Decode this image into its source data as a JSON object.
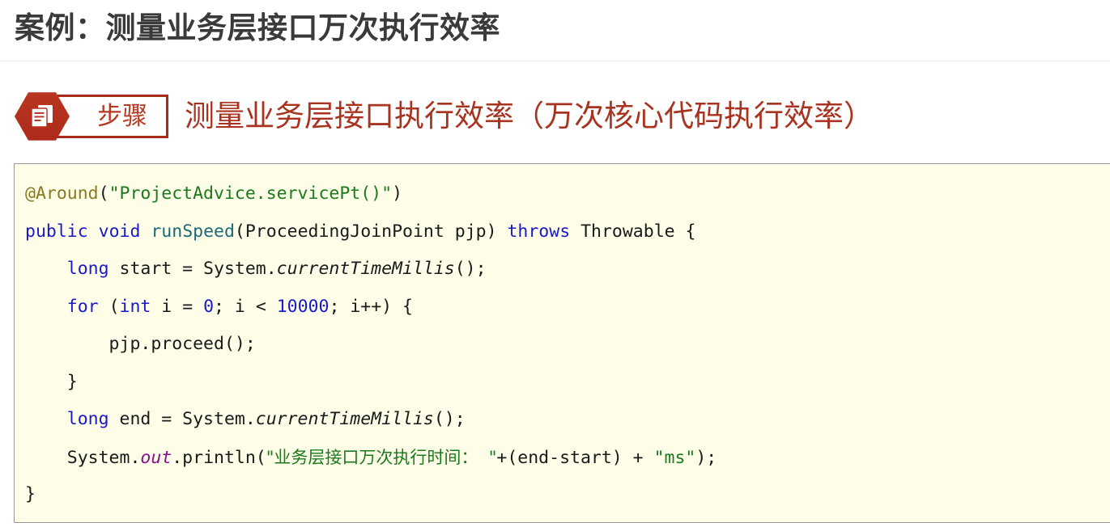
{
  "page": {
    "title": "案例：测量业务层接口万次执行效率"
  },
  "step": {
    "badge_icon": "document-list-icon",
    "label": "步骤",
    "heading": "测量业务层接口执行效率（万次核心代码执行效率）",
    "badge_color": "#b5301f",
    "border_color": "#a82a19",
    "heading_color": "#a83420"
  },
  "code": {
    "language": "java",
    "background": "#fdfde8",
    "border_color": "#9a9a9a",
    "lines": [
      [
        {
          "t": "@Around",
          "c": "tok-ann"
        },
        {
          "t": "(",
          "c": "tok-plain"
        },
        {
          "t": "\"ProjectAdvice.servicePt()\"",
          "c": "tok-str"
        },
        {
          "t": ")",
          "c": "tok-plain"
        }
      ],
      [
        {
          "t": "public",
          "c": "tok-kw"
        },
        {
          "t": " ",
          "c": "tok-plain"
        },
        {
          "t": "void",
          "c": "tok-kw"
        },
        {
          "t": " ",
          "c": "tok-plain"
        },
        {
          "t": "runSpeed",
          "c": "tok-meth"
        },
        {
          "t": "(ProceedingJoinPoint pjp) ",
          "c": "tok-plain"
        },
        {
          "t": "throws",
          "c": "tok-kw"
        },
        {
          "t": " Throwable {",
          "c": "tok-plain"
        }
      ],
      [
        {
          "t": "    ",
          "c": "tok-plain"
        },
        {
          "t": "long",
          "c": "tok-kw"
        },
        {
          "t": " start = System.",
          "c": "tok-plain"
        },
        {
          "t": "currentTimeMillis",
          "c": "tok-italic"
        },
        {
          "t": "();",
          "c": "tok-plain"
        }
      ],
      [
        {
          "t": "    ",
          "c": "tok-plain"
        },
        {
          "t": "for",
          "c": "tok-kw"
        },
        {
          "t": " (",
          "c": "tok-plain"
        },
        {
          "t": "int",
          "c": "tok-kw"
        },
        {
          "t": " i = ",
          "c": "tok-plain"
        },
        {
          "t": "0",
          "c": "tok-num"
        },
        {
          "t": "; i < ",
          "c": "tok-plain"
        },
        {
          "t": "10000",
          "c": "tok-num"
        },
        {
          "t": "; i++) {",
          "c": "tok-plain"
        }
      ],
      [
        {
          "t": "        pjp.proceed();",
          "c": "tok-plain"
        }
      ],
      [
        {
          "t": "    }",
          "c": "tok-plain"
        }
      ],
      [
        {
          "t": "    ",
          "c": "tok-plain"
        },
        {
          "t": "long",
          "c": "tok-kw"
        },
        {
          "t": " end = System.",
          "c": "tok-plain"
        },
        {
          "t": "currentTimeMillis",
          "c": "tok-italic"
        },
        {
          "t": "();",
          "c": "tok-plain"
        }
      ],
      [
        {
          "t": "    System.",
          "c": "tok-plain"
        },
        {
          "t": "out",
          "c": "tok-field"
        },
        {
          "t": ".println(",
          "c": "tok-plain"
        },
        {
          "t": "\"业务层接口万次执行时间：  \"",
          "c": "cjk-str"
        },
        {
          "t": "+(end-start) + ",
          "c": "tok-plain"
        },
        {
          "t": "\"ms\"",
          "c": "tok-str"
        },
        {
          "t": ");",
          "c": "tok-plain"
        }
      ],
      [
        {
          "t": "}",
          "c": "tok-plain"
        }
      ]
    ]
  }
}
